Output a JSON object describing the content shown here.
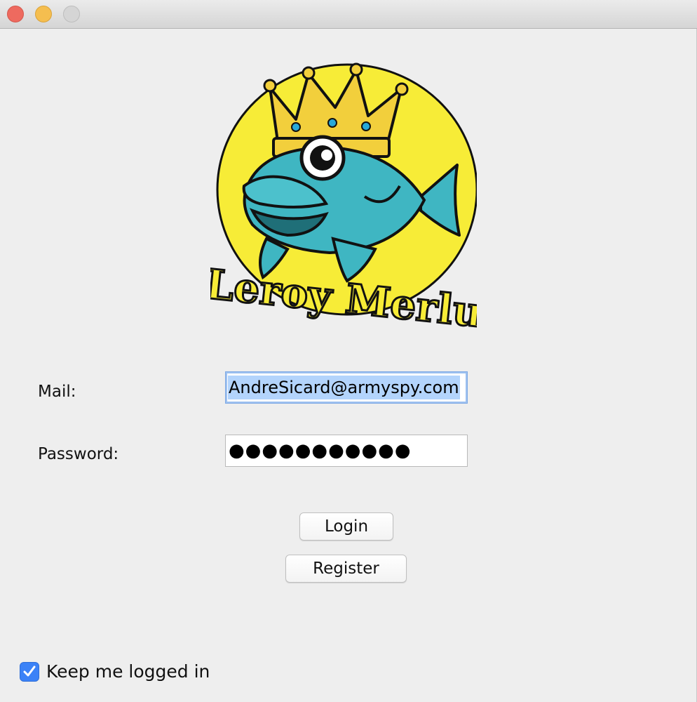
{
  "window": {
    "controls": [
      "close",
      "minimize",
      "zoom"
    ]
  },
  "logo": {
    "text": "Leroy Merlu"
  },
  "form": {
    "mail_label": "Mail:",
    "mail_value": "AndreSicard@armyspy.com",
    "password_label": "Password:",
    "password_value": "●●●●●●●●●●●"
  },
  "buttons": {
    "login_label": "Login",
    "register_label": "Register"
  },
  "options": {
    "keep_logged_in_label": "Keep me logged in",
    "keep_logged_in_checked": true
  },
  "colors": {
    "selection": "#b3d4fc",
    "accent": "#3b82f7",
    "logo_yellow": "#f7ec37",
    "fish_teal": "#3fb6c2"
  }
}
